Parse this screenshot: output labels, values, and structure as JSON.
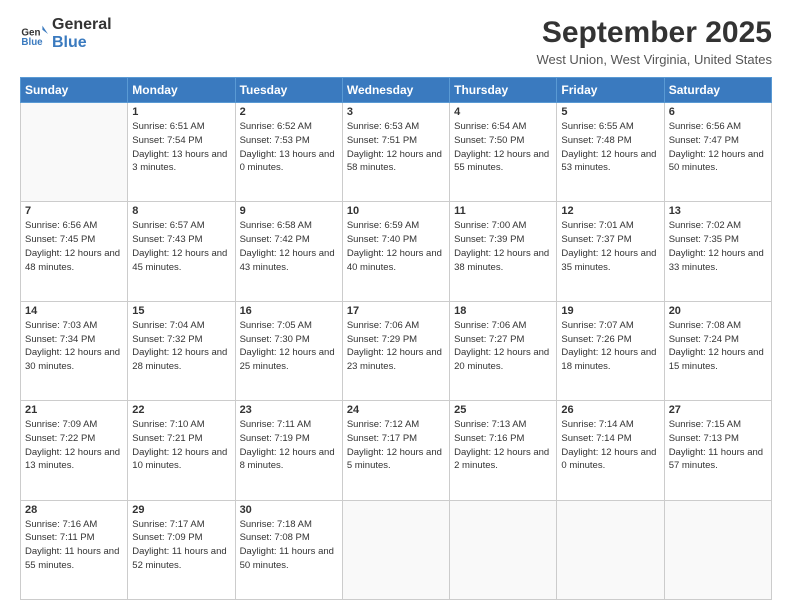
{
  "header": {
    "logo": {
      "general": "General",
      "blue": "Blue"
    },
    "title": "September 2025",
    "location": "West Union, West Virginia, United States"
  },
  "weekdays": [
    "Sunday",
    "Monday",
    "Tuesday",
    "Wednesday",
    "Thursday",
    "Friday",
    "Saturday"
  ],
  "weeks": [
    [
      {
        "day": "",
        "sunrise": "",
        "sunset": "",
        "daylight": ""
      },
      {
        "day": "1",
        "sunrise": "Sunrise: 6:51 AM",
        "sunset": "Sunset: 7:54 PM",
        "daylight": "Daylight: 13 hours and 3 minutes."
      },
      {
        "day": "2",
        "sunrise": "Sunrise: 6:52 AM",
        "sunset": "Sunset: 7:53 PM",
        "daylight": "Daylight: 13 hours and 0 minutes."
      },
      {
        "day": "3",
        "sunrise": "Sunrise: 6:53 AM",
        "sunset": "Sunset: 7:51 PM",
        "daylight": "Daylight: 12 hours and 58 minutes."
      },
      {
        "day": "4",
        "sunrise": "Sunrise: 6:54 AM",
        "sunset": "Sunset: 7:50 PM",
        "daylight": "Daylight: 12 hours and 55 minutes."
      },
      {
        "day": "5",
        "sunrise": "Sunrise: 6:55 AM",
        "sunset": "Sunset: 7:48 PM",
        "daylight": "Daylight: 12 hours and 53 minutes."
      },
      {
        "day": "6",
        "sunrise": "Sunrise: 6:56 AM",
        "sunset": "Sunset: 7:47 PM",
        "daylight": "Daylight: 12 hours and 50 minutes."
      }
    ],
    [
      {
        "day": "7",
        "sunrise": "Sunrise: 6:56 AM",
        "sunset": "Sunset: 7:45 PM",
        "daylight": "Daylight: 12 hours and 48 minutes."
      },
      {
        "day": "8",
        "sunrise": "Sunrise: 6:57 AM",
        "sunset": "Sunset: 7:43 PM",
        "daylight": "Daylight: 12 hours and 45 minutes."
      },
      {
        "day": "9",
        "sunrise": "Sunrise: 6:58 AM",
        "sunset": "Sunset: 7:42 PM",
        "daylight": "Daylight: 12 hours and 43 minutes."
      },
      {
        "day": "10",
        "sunrise": "Sunrise: 6:59 AM",
        "sunset": "Sunset: 7:40 PM",
        "daylight": "Daylight: 12 hours and 40 minutes."
      },
      {
        "day": "11",
        "sunrise": "Sunrise: 7:00 AM",
        "sunset": "Sunset: 7:39 PM",
        "daylight": "Daylight: 12 hours and 38 minutes."
      },
      {
        "day": "12",
        "sunrise": "Sunrise: 7:01 AM",
        "sunset": "Sunset: 7:37 PM",
        "daylight": "Daylight: 12 hours and 35 minutes."
      },
      {
        "day": "13",
        "sunrise": "Sunrise: 7:02 AM",
        "sunset": "Sunset: 7:35 PM",
        "daylight": "Daylight: 12 hours and 33 minutes."
      }
    ],
    [
      {
        "day": "14",
        "sunrise": "Sunrise: 7:03 AM",
        "sunset": "Sunset: 7:34 PM",
        "daylight": "Daylight: 12 hours and 30 minutes."
      },
      {
        "day": "15",
        "sunrise": "Sunrise: 7:04 AM",
        "sunset": "Sunset: 7:32 PM",
        "daylight": "Daylight: 12 hours and 28 minutes."
      },
      {
        "day": "16",
        "sunrise": "Sunrise: 7:05 AM",
        "sunset": "Sunset: 7:30 PM",
        "daylight": "Daylight: 12 hours and 25 minutes."
      },
      {
        "day": "17",
        "sunrise": "Sunrise: 7:06 AM",
        "sunset": "Sunset: 7:29 PM",
        "daylight": "Daylight: 12 hours and 23 minutes."
      },
      {
        "day": "18",
        "sunrise": "Sunrise: 7:06 AM",
        "sunset": "Sunset: 7:27 PM",
        "daylight": "Daylight: 12 hours and 20 minutes."
      },
      {
        "day": "19",
        "sunrise": "Sunrise: 7:07 AM",
        "sunset": "Sunset: 7:26 PM",
        "daylight": "Daylight: 12 hours and 18 minutes."
      },
      {
        "day": "20",
        "sunrise": "Sunrise: 7:08 AM",
        "sunset": "Sunset: 7:24 PM",
        "daylight": "Daylight: 12 hours and 15 minutes."
      }
    ],
    [
      {
        "day": "21",
        "sunrise": "Sunrise: 7:09 AM",
        "sunset": "Sunset: 7:22 PM",
        "daylight": "Daylight: 12 hours and 13 minutes."
      },
      {
        "day": "22",
        "sunrise": "Sunrise: 7:10 AM",
        "sunset": "Sunset: 7:21 PM",
        "daylight": "Daylight: 12 hours and 10 minutes."
      },
      {
        "day": "23",
        "sunrise": "Sunrise: 7:11 AM",
        "sunset": "Sunset: 7:19 PM",
        "daylight": "Daylight: 12 hours and 8 minutes."
      },
      {
        "day": "24",
        "sunrise": "Sunrise: 7:12 AM",
        "sunset": "Sunset: 7:17 PM",
        "daylight": "Daylight: 12 hours and 5 minutes."
      },
      {
        "day": "25",
        "sunrise": "Sunrise: 7:13 AM",
        "sunset": "Sunset: 7:16 PM",
        "daylight": "Daylight: 12 hours and 2 minutes."
      },
      {
        "day": "26",
        "sunrise": "Sunrise: 7:14 AM",
        "sunset": "Sunset: 7:14 PM",
        "daylight": "Daylight: 12 hours and 0 minutes."
      },
      {
        "day": "27",
        "sunrise": "Sunrise: 7:15 AM",
        "sunset": "Sunset: 7:13 PM",
        "daylight": "Daylight: 11 hours and 57 minutes."
      }
    ],
    [
      {
        "day": "28",
        "sunrise": "Sunrise: 7:16 AM",
        "sunset": "Sunset: 7:11 PM",
        "daylight": "Daylight: 11 hours and 55 minutes."
      },
      {
        "day": "29",
        "sunrise": "Sunrise: 7:17 AM",
        "sunset": "Sunset: 7:09 PM",
        "daylight": "Daylight: 11 hours and 52 minutes."
      },
      {
        "day": "30",
        "sunrise": "Sunrise: 7:18 AM",
        "sunset": "Sunset: 7:08 PM",
        "daylight": "Daylight: 11 hours and 50 minutes."
      },
      {
        "day": "",
        "sunrise": "",
        "sunset": "",
        "daylight": ""
      },
      {
        "day": "",
        "sunrise": "",
        "sunset": "",
        "daylight": ""
      },
      {
        "day": "",
        "sunrise": "",
        "sunset": "",
        "daylight": ""
      },
      {
        "day": "",
        "sunrise": "",
        "sunset": "",
        "daylight": ""
      }
    ]
  ]
}
